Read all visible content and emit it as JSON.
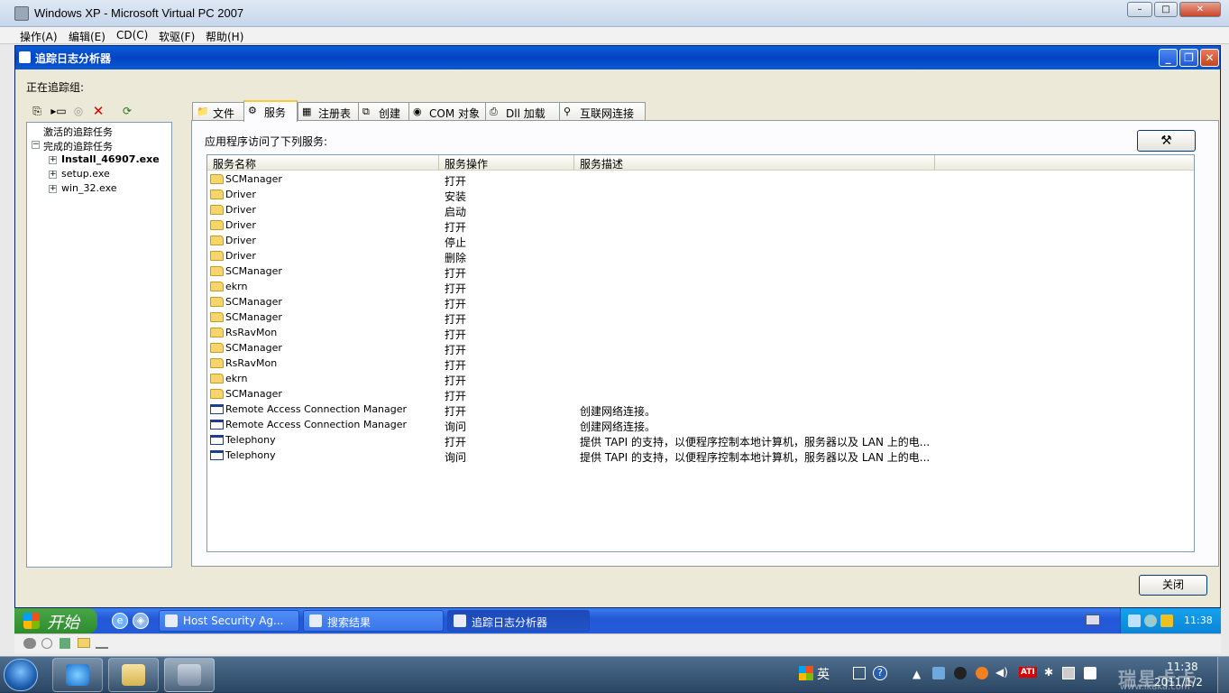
{
  "vpc": {
    "title": "Windows XP - Microsoft Virtual PC 2007",
    "menu": [
      "操作(A)",
      "编辑(E)",
      "CD(C)",
      "软驱(F)",
      "帮助(H)"
    ],
    "window_buttons": [
      "–",
      "□",
      "✕"
    ]
  },
  "app": {
    "title": "追踪日志分析器",
    "group_label": "正在追踪组:",
    "tree": {
      "active": "激活的追踪任务",
      "completed": "完成的追踪任务",
      "items": [
        "Install_46907.exe",
        "setup.exe",
        "win_32.exe"
      ]
    },
    "tabs": [
      "文件",
      "服务",
      "注册表",
      "创建",
      "COM 对象",
      "Dll 加载",
      "互联网连接"
    ],
    "active_tab": "服务",
    "pane_caption": "应用程序访问了下列服务:",
    "columns": [
      "服务名称",
      "服务操作",
      "服务描述",
      ""
    ],
    "rows": [
      {
        "icon": "folder-icon",
        "name": "SCManager",
        "op": "打开",
        "desc": ""
      },
      {
        "icon": "folder-icon",
        "name": "Driver",
        "op": "安装",
        "desc": ""
      },
      {
        "icon": "folder-icon",
        "name": "Driver",
        "op": "启动",
        "desc": ""
      },
      {
        "icon": "folder-icon",
        "name": "Driver",
        "op": "打开",
        "desc": ""
      },
      {
        "icon": "folder-icon",
        "name": "Driver",
        "op": "停止",
        "desc": ""
      },
      {
        "icon": "folder-icon",
        "name": "Driver",
        "op": "删除",
        "desc": ""
      },
      {
        "icon": "folder-icon",
        "name": "SCManager",
        "op": "打开",
        "desc": ""
      },
      {
        "icon": "folder-icon",
        "name": "ekrn",
        "op": "打开",
        "desc": ""
      },
      {
        "icon": "folder-icon",
        "name": "SCManager",
        "op": "打开",
        "desc": ""
      },
      {
        "icon": "folder-icon",
        "name": "SCManager",
        "op": "打开",
        "desc": ""
      },
      {
        "icon": "folder-icon",
        "name": "RsRavMon",
        "op": "打开",
        "desc": ""
      },
      {
        "icon": "folder-icon",
        "name": "SCManager",
        "op": "打开",
        "desc": ""
      },
      {
        "icon": "folder-icon",
        "name": "RsRavMon",
        "op": "打开",
        "desc": ""
      },
      {
        "icon": "folder-icon",
        "name": "ekrn",
        "op": "打开",
        "desc": ""
      },
      {
        "icon": "folder-icon",
        "name": "SCManager",
        "op": "打开",
        "desc": ""
      },
      {
        "icon": "window-icon",
        "name": "Remote Access Connection Manager",
        "op": "打开",
        "desc": "创建网络连接。"
      },
      {
        "icon": "window-icon",
        "name": "Remote Access Connection Manager",
        "op": "询问",
        "desc": "创建网络连接。"
      },
      {
        "icon": "window-icon",
        "name": "Telephony",
        "op": "打开",
        "desc": "提供 TAPI 的支持，以便程序控制本地计算机，服务器以及 LAN 上的电..."
      },
      {
        "icon": "window-icon",
        "name": "Telephony",
        "op": "询问",
        "desc": "提供 TAPI 的支持，以便程序控制本地计算机，服务器以及 LAN 上的电..."
      }
    ],
    "close_label": "关闭"
  },
  "xp_taskbar": {
    "start": "开始",
    "buttons": [
      "Host Security Ag...",
      "搜索结果",
      "追踪日志分析器"
    ],
    "active_button": "追踪日志分析器",
    "clock": "11:38"
  },
  "win7": {
    "ime": "英",
    "clock_time": "11:38",
    "clock_date": "2011/1/2",
    "watermark": "瑞星卡卡",
    "watermark_url": "www.ikaka.com"
  }
}
